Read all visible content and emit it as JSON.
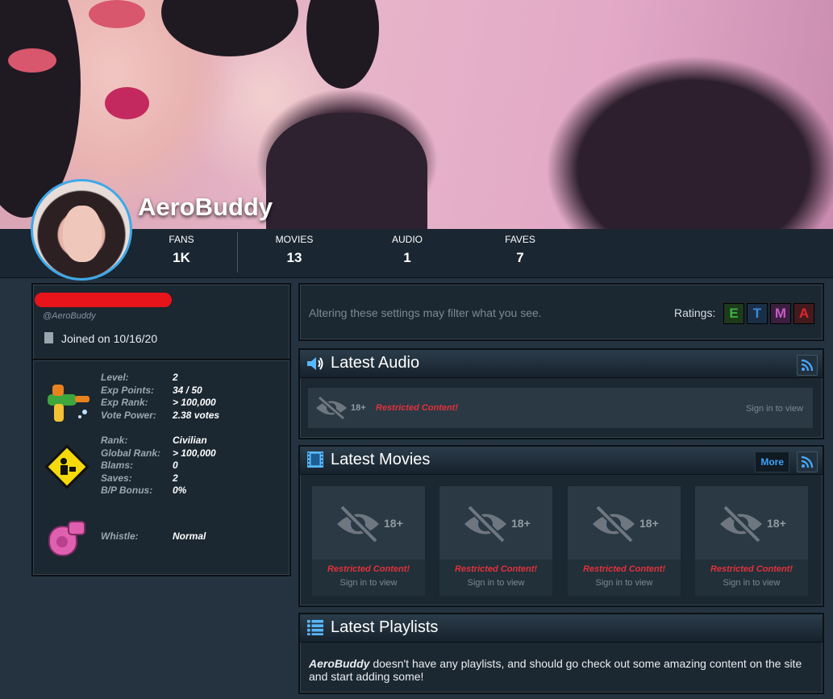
{
  "profile": {
    "username": "AeroBuddy",
    "handle": "@AeroBuddy",
    "joined": "Joined on 10/16/20"
  },
  "stats": [
    {
      "label": "FANS",
      "value": "1K"
    },
    {
      "label": "MOVIES",
      "value": "13"
    },
    {
      "label": "AUDIO",
      "value": "1"
    },
    {
      "label": "FAVES",
      "value": "7"
    }
  ],
  "level_block": {
    "rows": [
      {
        "key": "Level:",
        "value": "2"
      },
      {
        "key": "Exp Points:",
        "value": "34 / 50"
      },
      {
        "key": "Exp Rank:",
        "value": "> 100,000"
      },
      {
        "key": "Vote Power:",
        "value": "2.38 votes"
      }
    ]
  },
  "rank_block": {
    "rows": [
      {
        "key": "Rank:",
        "value": "Civilian"
      },
      {
        "key": "Global Rank:",
        "value": "> 100,000"
      },
      {
        "key": "Blams:",
        "value": "0"
      },
      {
        "key": "Saves:",
        "value": "2"
      },
      {
        "key": "B/P Bonus:",
        "value": "0%"
      }
    ]
  },
  "whistle_block": {
    "key": "Whistle:",
    "value": "Normal"
  },
  "settings": {
    "message": "Altering these settings may filter what you see.",
    "ratings_label": "Ratings:",
    "ratings": [
      {
        "letter": "E",
        "color": "#3cb33c",
        "bg": "#1d3a1d"
      },
      {
        "letter": "T",
        "color": "#3a8ad8",
        "bg": "#1a2f45"
      },
      {
        "letter": "M",
        "color": "#c55ac9",
        "bg": "#3b1f3e"
      },
      {
        "letter": "A",
        "color": "#e2262f",
        "bg": "#431b1e"
      }
    ]
  },
  "audio": {
    "title": "Latest Audio",
    "item": {
      "age": "18+",
      "restricted": "Restricted Content!",
      "signin": "Sign in to view"
    }
  },
  "movies": {
    "title": "Latest Movies",
    "more_label": "More",
    "items": [
      {
        "age": "18+",
        "restricted": "Restricted Content!",
        "signin": "Sign in to view"
      },
      {
        "age": "18+",
        "restricted": "Restricted Content!",
        "signin": "Sign in to view"
      },
      {
        "age": "18+",
        "restricted": "Restricted Content!",
        "signin": "Sign in to view"
      },
      {
        "age": "18+",
        "restricted": "Restricted Content!",
        "signin": "Sign in to view"
      }
    ]
  },
  "playlists": {
    "title": "Latest Playlists",
    "user": "AeroBuddy",
    "text": " doesn't have any playlists, and should go check out some amazing content on the site and start adding some!"
  }
}
